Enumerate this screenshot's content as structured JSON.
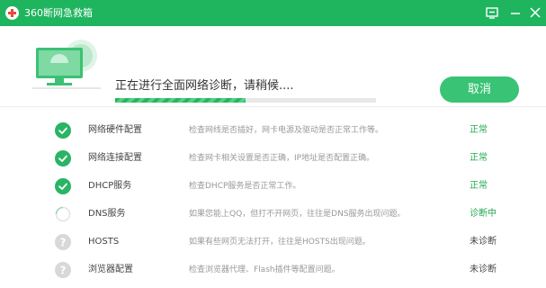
{
  "window": {
    "title": "360断网急救箱",
    "buttons": {
      "feedback_icon": "feedback-icon",
      "minimize_icon": "minimize-icon",
      "close_icon": "close-icon"
    }
  },
  "header": {
    "status_text": "正在进行全面网络诊断，请稍候....",
    "progress_fraction": 0.5,
    "cancel_label": "取消"
  },
  "colors": {
    "accent": "#1fb55f",
    "ok": "#22a84f",
    "in_progress": "#22a84f",
    "pending": "#444444"
  },
  "checks": [
    {
      "name": "网络硬件配置",
      "description": "检查网线是否插好，网卡电源及驱动是否正常工作等。",
      "status": "正常",
      "state": "ok"
    },
    {
      "name": "网络连接配置",
      "description": "检查网卡相关设置是否正确，IP地址是否配置正确。",
      "status": "正常",
      "state": "ok"
    },
    {
      "name": "DHCP服务",
      "description": "检查DHCP服务是否正常工作。",
      "status": "正常",
      "state": "ok"
    },
    {
      "name": "DNS服务",
      "description": "如果您能上QQ，但打不开网页，往往是DNS服务出现问题。",
      "status": "诊断中",
      "state": "in_progress"
    },
    {
      "name": "HOSTS",
      "description": "如果有些网页无法打开，往往是HOSTS出现问题。",
      "status": "未诊断",
      "state": "pending"
    },
    {
      "name": "浏览器配置",
      "description": "检查浏览器代理、Flash插件等配置问题。",
      "status": "未诊断",
      "state": "pending"
    }
  ]
}
